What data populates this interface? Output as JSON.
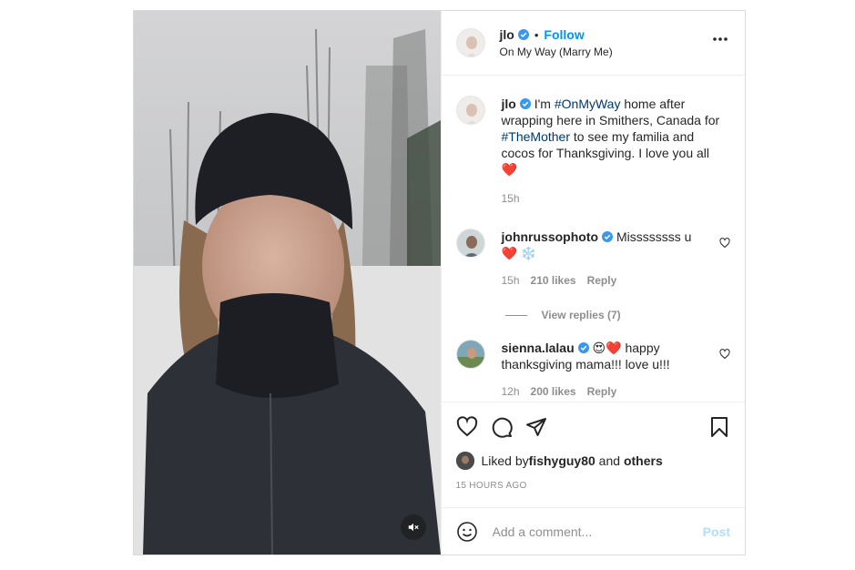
{
  "header": {
    "username": "jlo",
    "separator": "•",
    "follow_label": "Follow",
    "subtitle": "On My Way (Marry Me)",
    "more_icon": "more-horizontal-icon"
  },
  "caption": {
    "username": "jlo",
    "text_pre": "I'm ",
    "tag1": "#OnMyWay",
    "text_mid": " home after wrapping here in Smithers, Canada for ",
    "tag2": "#TheMother",
    "text_post": " to see my familia and cocos for Thanksgiving. I love you all ",
    "emoji": "❤️",
    "time": "15h"
  },
  "comments": [
    {
      "username": "johnrussophoto",
      "text": "Missssssss u ❤️ ❄️",
      "time": "15h",
      "likes": "210 likes",
      "reply": "Reply"
    },
    {
      "username": "sienna.lalau",
      "text": "😍❤️ happy thanksgiving mama!!! love u!!!",
      "time": "12h",
      "likes": "200 likes",
      "reply": "Reply"
    }
  ],
  "view_replies": "View replies (7)",
  "liked_by": {
    "prefix": "Liked by ",
    "user": "fishyguy80",
    "mid": " and ",
    "others": "others"
  },
  "time_ago": "15 HOURS AGO",
  "add_comment": {
    "placeholder": "Add a comment...",
    "post_label": "Post"
  },
  "colors": {
    "accent": "#0095f6",
    "hashtag": "#00376b",
    "muted": "#8e8e8e",
    "heart": "#ed1c24"
  }
}
